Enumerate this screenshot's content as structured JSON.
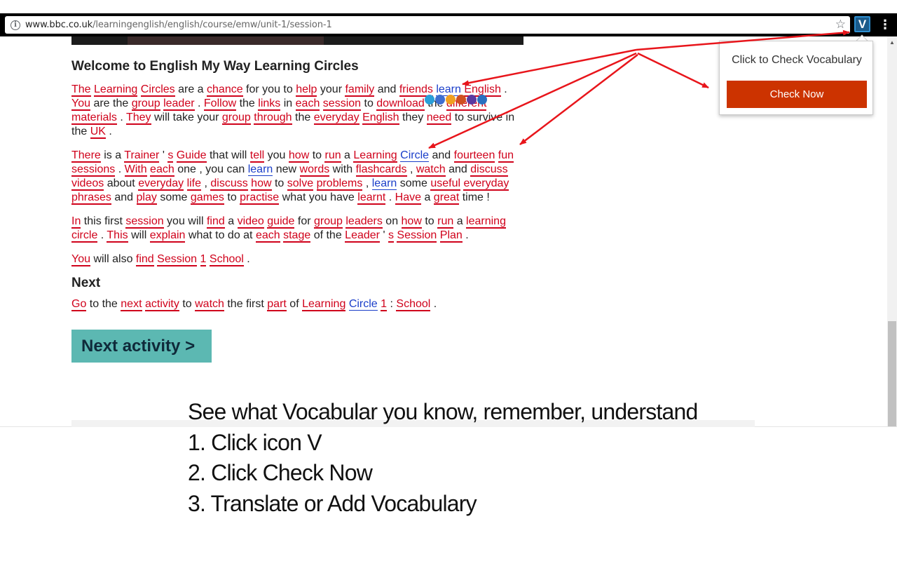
{
  "browser": {
    "url_host": "www.bbc.co.uk",
    "url_path": "/learningenglish/english/course/emw/unit-1/session-1",
    "extension_letter": "V",
    "info_icon": "info-icon",
    "star_icon": "star-icon",
    "menu_icon": "kebab-menu-icon"
  },
  "page": {
    "title": "Welcome to English My Way Learning Circles",
    "next_heading": "Next",
    "next_button_label": "Next activity  >"
  },
  "popup": {
    "text": "Click to Check Vocabulary",
    "button": "Check Now"
  },
  "instructions": {
    "line1": "See what Vocabular you know, remember, understand",
    "line2": "1. Click icon V",
    "line3": "2. Click Check Now",
    "line4": "3. Translate or Add Vocabulary"
  },
  "paragraphs": [
    [
      [
        "r",
        "The"
      ],
      " ",
      [
        "r",
        "Learning"
      ],
      " ",
      [
        "r",
        "Circles"
      ],
      " are a ",
      [
        "r",
        "chance"
      ],
      " for you to ",
      [
        "r",
        "help"
      ],
      " your ",
      [
        "r",
        "family"
      ],
      " and ",
      [
        "r",
        "friends"
      ],
      " ",
      [
        "b",
        "learn"
      ],
      " ",
      [
        "r",
        "English"
      ],
      " . ",
      [
        "r",
        "You"
      ],
      " are the ",
      [
        "r",
        "group"
      ],
      " ",
      [
        "r",
        "leader"
      ],
      " . ",
      [
        "r",
        "Follow"
      ],
      " the ",
      [
        "r",
        "links"
      ],
      " in ",
      [
        "r",
        "each"
      ],
      " ",
      [
        "r",
        "session"
      ],
      " to ",
      [
        "r",
        "download"
      ],
      " the ",
      [
        "r",
        "different"
      ],
      " ",
      [
        "r",
        "materials"
      ],
      " . ",
      [
        "r",
        "They"
      ],
      " will take your ",
      [
        "r",
        "group"
      ],
      " ",
      [
        "r",
        "through"
      ],
      " the ",
      [
        "r",
        "everyday"
      ],
      " ",
      [
        "r",
        "English"
      ],
      " they ",
      [
        "r",
        "need"
      ],
      " to survive in the ",
      [
        "r",
        "UK"
      ],
      " ."
    ],
    [
      [
        "r",
        "There"
      ],
      " is a ",
      [
        "r",
        "Trainer"
      ],
      " ' ",
      [
        "r",
        "s"
      ],
      " ",
      [
        "r",
        "Guide"
      ],
      " that will ",
      [
        "r",
        "tell"
      ],
      " you ",
      [
        "r",
        "how"
      ],
      " to ",
      [
        "r",
        "run"
      ],
      " a ",
      [
        "r",
        "Learning"
      ],
      " ",
      [
        "b",
        "Circle"
      ],
      " and ",
      [
        "r",
        "fourteen"
      ],
      " ",
      [
        "r",
        "fun"
      ],
      " ",
      [
        "r",
        "sessions"
      ],
      " . ",
      [
        "r",
        "With"
      ],
      " ",
      [
        "r",
        "each"
      ],
      " one , you can ",
      [
        "b",
        "learn"
      ],
      " new ",
      [
        "r",
        "words"
      ],
      " with ",
      [
        "r",
        "flashcards"
      ],
      " , ",
      [
        "r",
        "watch"
      ],
      " and ",
      [
        "r",
        "discuss"
      ],
      " ",
      [
        "r",
        "videos"
      ],
      " about ",
      [
        "r",
        "everyday"
      ],
      " ",
      [
        "r",
        "life"
      ],
      " , ",
      [
        "r",
        "discuss"
      ],
      " ",
      [
        "r",
        "how"
      ],
      " to ",
      [
        "r",
        "solve"
      ],
      " ",
      [
        "r",
        "problems"
      ],
      " , ",
      [
        "b",
        "learn"
      ],
      " some ",
      [
        "r",
        "useful"
      ],
      " ",
      [
        "r",
        "everyday"
      ],
      " ",
      [
        "r",
        "phrases"
      ],
      " and ",
      [
        "r",
        "play"
      ],
      " some ",
      [
        "r",
        "games"
      ],
      " to ",
      [
        "r",
        "practise"
      ],
      " what you have ",
      [
        "r",
        "learnt"
      ],
      " . ",
      [
        "r",
        "Have"
      ],
      " a ",
      [
        "r",
        "great"
      ],
      " time !"
    ],
    [
      [
        "r",
        "In"
      ],
      " this first ",
      [
        "r",
        "session"
      ],
      " you will ",
      [
        "r",
        "find"
      ],
      " a ",
      [
        "r",
        "video"
      ],
      " ",
      [
        "r",
        "guide"
      ],
      " for ",
      [
        "r",
        "group"
      ],
      " ",
      [
        "r",
        "leaders"
      ],
      " on ",
      [
        "r",
        "how"
      ],
      " to ",
      [
        "r",
        "run"
      ],
      " a ",
      [
        "r",
        "learning"
      ],
      " ",
      [
        "r",
        "circle"
      ],
      " . ",
      [
        "r",
        "This"
      ],
      " will ",
      [
        "r",
        "explain"
      ],
      " what to do at ",
      [
        "r",
        "each"
      ],
      " ",
      [
        "r",
        "stage"
      ],
      " of the ",
      [
        "r",
        "Leader"
      ],
      " ' ",
      [
        "r",
        "s"
      ],
      " ",
      [
        "r",
        "Session"
      ],
      " ",
      [
        "r",
        "Plan"
      ],
      " ."
    ],
    [
      [
        "r",
        "You"
      ],
      " will also ",
      [
        "r",
        "find"
      ],
      " ",
      [
        "r",
        "Session"
      ],
      " ",
      [
        "r",
        "1"
      ],
      " ",
      [
        "r",
        "School"
      ],
      " ."
    ]
  ],
  "next_paragraph": [
    [
      "r",
      "Go"
    ],
    " to the ",
    [
      "r",
      "next"
    ],
    " ",
    [
      "r",
      "activity"
    ],
    " to ",
    [
      "r",
      "watch"
    ],
    " the first ",
    [
      "r",
      "part"
    ],
    " of ",
    [
      "r",
      "Learning"
    ],
    " ",
    [
      "b",
      "Circle"
    ],
    " ",
    [
      "r",
      "1"
    ],
    " : ",
    [
      "r",
      "School"
    ],
    " ."
  ],
  "colors": {
    "highlight_red": "#d0021b",
    "highlight_blue": "#1a3ec9",
    "next_button_bg": "#5cb8b2",
    "check_now_bg": "#cc3300",
    "annotation_arrow": "#e8151b"
  }
}
